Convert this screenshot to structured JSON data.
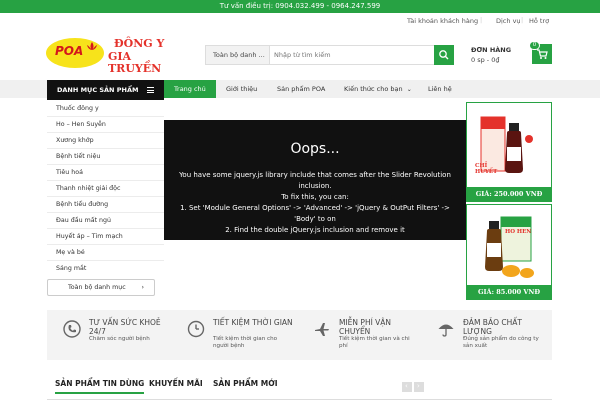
{
  "topbar": {
    "hotline": "Tư vấn điều trị: 0904.032.499 - 0964.247.599"
  },
  "account": {
    "customer": "Tài khoản khách hàng",
    "service": "Dịch vụ",
    "support": "Hỗ trợ"
  },
  "logo": {
    "brand": "POA",
    "name_line1": "ĐÔNG Y",
    "name_line2": "GIA TRUYỀN"
  },
  "search": {
    "category": "Toàn bộ danh ...",
    "placeholder": "Nhập từ tìm kiếm",
    "icon": "search-icon"
  },
  "cart": {
    "title": "ĐƠN HÀNG",
    "summary": "0 sp - 0₫",
    "count": "0",
    "icon": "cart-icon"
  },
  "nav": {
    "categories_label": "DANH MỤC SẢN PHẨM",
    "items": [
      {
        "label": "Trang chủ"
      },
      {
        "label": "Giới thiệu"
      },
      {
        "label": "Sản phẩm POA"
      },
      {
        "label": "Kiến thức cho bạn"
      },
      {
        "label": "Liên hệ"
      }
    ]
  },
  "sidebar": {
    "items": [
      {
        "label": "Thuốc đông y"
      },
      {
        "label": "Ho – Hen Suyễn"
      },
      {
        "label": "Xương khớp"
      },
      {
        "label": "Bệnh tiết niệu"
      },
      {
        "label": "Tiêu hoá"
      },
      {
        "label": "Thanh nhiệt giải độc"
      },
      {
        "label": "Bệnh tiểu đường"
      },
      {
        "label": "Đau đầu mất ngủ"
      },
      {
        "label": "Huyết áp – Tim mạch"
      },
      {
        "label": "Mẹ và bé"
      },
      {
        "label": "Sáng mắt"
      }
    ],
    "all_label": "Toàn bộ danh mục"
  },
  "slider": {
    "heading": "Oops...",
    "lines": [
      "You have some jquery.js library include that comes after the Slider Revolution",
      "inclusion.",
      "To fix this, you can:",
      "1. Set 'Module General Options' -> 'Advanced' -> 'jQuery & OutPut Filters' ->",
      "'Body' to on",
      "2. Find the double jQuery.js inclusion and remove it"
    ]
  },
  "banners": [
    {
      "product": "CHỈ HUYẾT",
      "price": "GIÁ: 250.000 VNĐ"
    },
    {
      "product": "HO HEN",
      "price": "GIÁ: 85.000 VNĐ"
    }
  ],
  "services": [
    {
      "title": "TƯ VẤN SỨC KHOẺ 24/7",
      "subtitle": "Chăm sóc người bệnh",
      "icon": "phone-icon"
    },
    {
      "title": "TIẾT KIỆM THỜI GIAN",
      "subtitle": "Tiết kiệm thời gian cho người bệnh",
      "icon": "clock-icon"
    },
    {
      "title": "MIỄN PHÍ VẬN CHUYỂN",
      "subtitle": "Tiết kiệm thời gian và chi phí",
      "icon": "plane-icon"
    },
    {
      "title": "ĐẢM BẢO CHẤT LƯỢNG",
      "subtitle": "Đúng sản phẩm do công ty sản xuất",
      "icon": "umbrella-icon"
    }
  ],
  "tabs": [
    {
      "label": "SẢN PHẨM TIN DÙNG"
    },
    {
      "label": "KHUYẾN MÃI"
    },
    {
      "label": "SẢN PHẨM MỚI"
    }
  ],
  "colors": {
    "brand": "#27a243",
    "dark": "#111111",
    "logo_red": "#d4161b",
    "logo_yellow": "#f7e31b"
  }
}
